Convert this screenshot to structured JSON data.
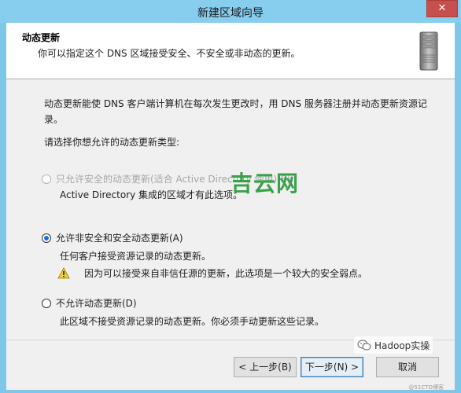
{
  "window": {
    "title": "新建区域向导",
    "close_glyph": "✕"
  },
  "header": {
    "title": "动态更新",
    "subtitle": "你可以指定这个 DNS 区域接受安全、不安全或非动态的更新。",
    "icon": "server-icon"
  },
  "body": {
    "description": "动态更新能使 DNS 客户端计算机在每次发生更改时，用 DNS 服务器注册并动态更新资源记录。",
    "prompt": "请选择你想允许的动态更新类型:",
    "options": [
      {
        "label": "只允许安全的动态更新(适合 Active Directory 使用)(S)",
        "note": "Active Directory 集成的区域才有此选项。",
        "checked": false,
        "disabled": true
      },
      {
        "label": "允许非安全和安全动态更新(A)",
        "note": "任何客户接受资源记录的动态更新。",
        "warning": "因为可以接受来自非信任源的更新，此选项是一个较大的安全弱点。",
        "checked": true,
        "disabled": false
      },
      {
        "label": "不允许动态更新(D)",
        "note": "此区域不接受资源记录的动态更新。你必须手动更新这些记录。",
        "checked": false,
        "disabled": false
      }
    ]
  },
  "watermark": {
    "center_text": "吉云网",
    "badge_text": "Hadoop实操",
    "blog_tag": "@51CTO博客"
  },
  "footer": {
    "back_label": "< 上一步(B)",
    "next_label": "下一步(N) >",
    "cancel_label": "取消"
  },
  "colors": {
    "titlebar": "#86cdee",
    "close": "#c7504e",
    "radio_dot": "#1b6fd0",
    "watermark": "#3aa14b"
  }
}
